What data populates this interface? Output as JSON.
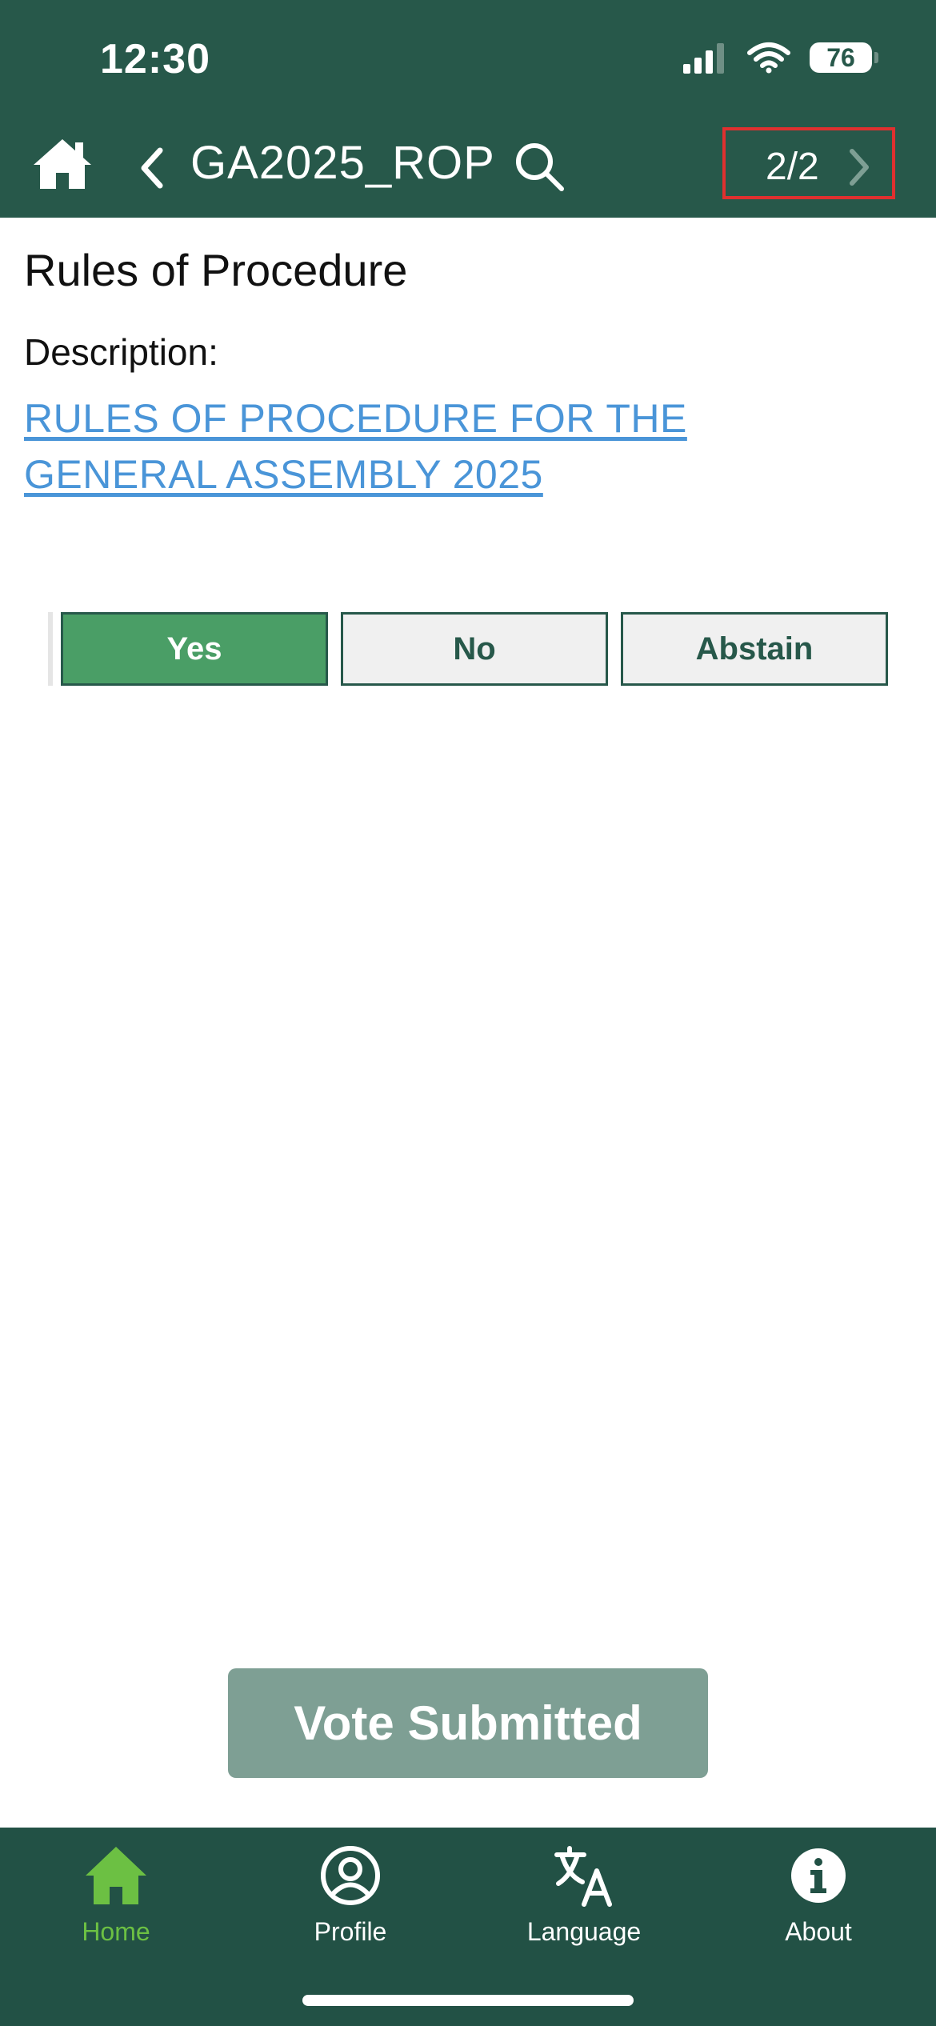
{
  "status_bar": {
    "time": "12:30",
    "battery": "76"
  },
  "header": {
    "title": "GA2025_ROP",
    "pager": "2/2"
  },
  "content": {
    "heading": "Rules of Procedure",
    "description_label": "Description:",
    "description_link": "RULES OF PROCEDURE FOR THE GENERAL ASSEMBLY 2025"
  },
  "vote": {
    "options": [
      "Yes",
      "No",
      "Abstain"
    ],
    "selected": "Yes"
  },
  "submit_label": "Vote Submitted",
  "tabs": [
    {
      "label": "Home",
      "icon": "home-icon",
      "active": true
    },
    {
      "label": "Profile",
      "icon": "profile-icon",
      "active": false
    },
    {
      "label": "Language",
      "icon": "language-icon",
      "active": false
    },
    {
      "label": "About",
      "icon": "info-icon",
      "active": false
    }
  ],
  "colors": {
    "brand": "#27584a",
    "tabbar": "#225145",
    "accent_active": "#6cc043",
    "yes_selected": "#4a9e66",
    "link": "#4a95d8",
    "submit_disabled": "#7e9f94",
    "highlight_box": "#e0302f"
  }
}
